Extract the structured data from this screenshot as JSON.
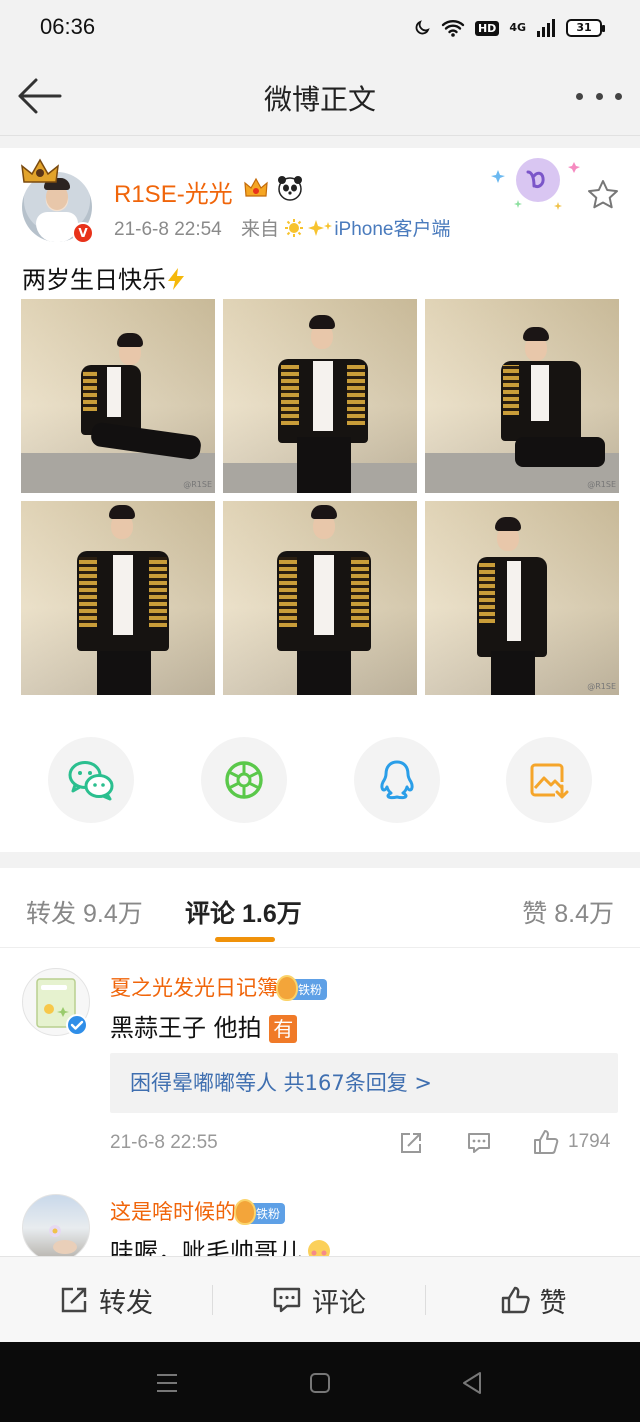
{
  "status_bar": {
    "time": "06:36",
    "hd": "HD",
    "network": "4G",
    "battery": "31"
  },
  "header": {
    "title": "微博正文"
  },
  "post": {
    "username": "R1SE-光光",
    "date": "21-6-8 22:54",
    "source_prefix": "来自",
    "source_name": "iPhone客户端",
    "text": "两岁生日快乐",
    "photo_count": 6,
    "photo_watermark": "@R1SE"
  },
  "share_targets": [
    "wechat-icon",
    "moments-icon",
    "qq-icon",
    "save-image-icon"
  ],
  "tabs": {
    "repost_label": "转发",
    "repost_count": "9.4万",
    "comment_label": "评论",
    "comment_count": "1.6万",
    "like_label": "赞",
    "like_count": "8.4万"
  },
  "comments": [
    {
      "name": "夏之光发光日记簿",
      "badge": "铁粉",
      "text": "黑蒜王子 他拍",
      "emoji_box": "有",
      "reply_summary": "困得晕嘟嘟等人 共167条回复 >",
      "time": "21-6-8 22:55",
      "like_count": "1794"
    },
    {
      "name": "这是啥时候的",
      "badge": "铁粉",
      "text": "哇喔，呲毛帅哥儿"
    }
  ],
  "bottom_bar": {
    "repost": "转发",
    "comment": "评论",
    "like": "赞"
  },
  "colors": {
    "username_orange": "#f0650a",
    "link_blue": "#3f6fb0",
    "tab_accent": "#f0920a",
    "verified_red": "#e8321a"
  }
}
